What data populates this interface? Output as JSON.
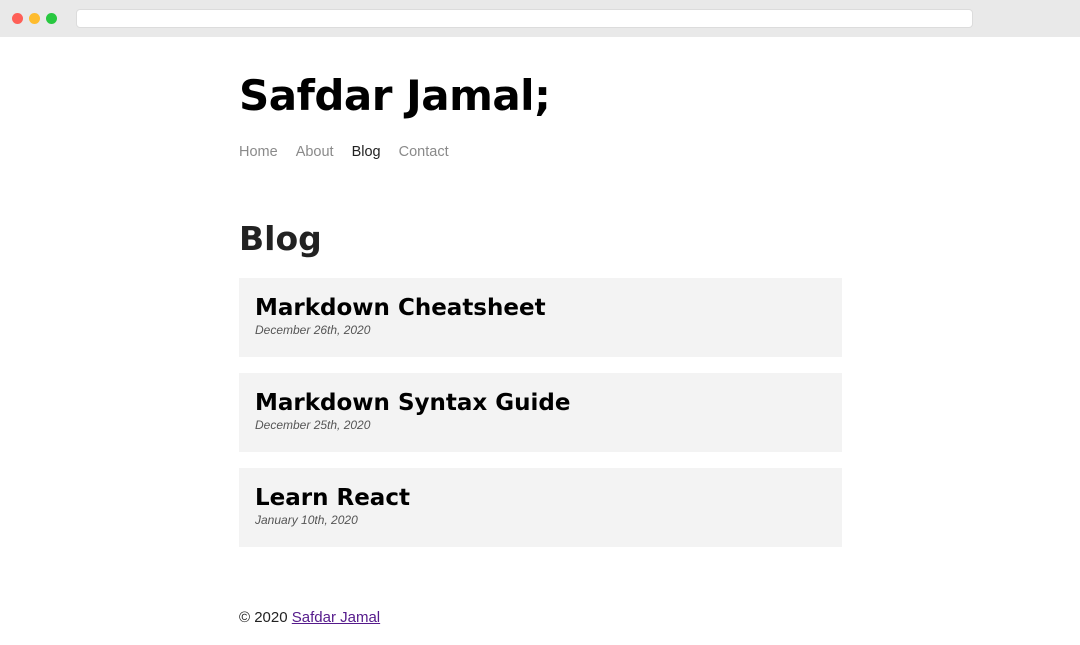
{
  "site": {
    "title": "Safdar Jamal;"
  },
  "nav": {
    "items": [
      {
        "label": "Home"
      },
      {
        "label": "About"
      },
      {
        "label": "Blog"
      },
      {
        "label": "Contact"
      }
    ],
    "active": "Blog"
  },
  "blog": {
    "heading": "Blog",
    "posts": [
      {
        "title": "Markdown Cheatsheet",
        "date": "December 26th, 2020"
      },
      {
        "title": "Markdown Syntax Guide",
        "date": "December 25th, 2020"
      },
      {
        "title": "Learn React",
        "date": "January 10th, 2020"
      }
    ]
  },
  "footer": {
    "copyright": "© 2020",
    "author_link": "Safdar Jamal"
  },
  "colors": {
    "post_card_bg": "#f3f3f3",
    "nav_inactive": "#8a8a8a",
    "link_visited": "#551a8b"
  }
}
